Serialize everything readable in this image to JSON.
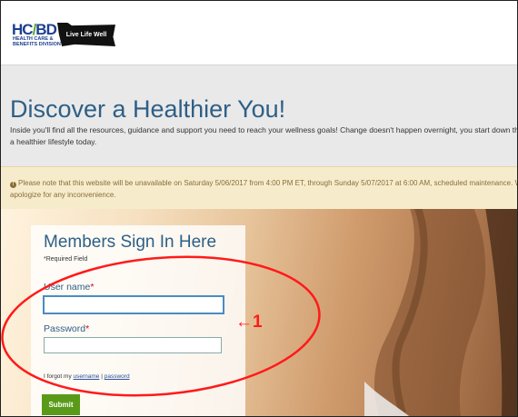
{
  "header": {
    "logo_text": "HC",
    "logo_slash": "/",
    "logo_text2": "BD",
    "logo_sub": "HEALTH CARE & BENEFITS DIVISION",
    "badge": "Live Life Well"
  },
  "hero": {
    "title": "Discover a Healthier You!",
    "description": "Inside you'll find all the resources, guidance and support you need to reach your wellness goals! Change doesn't happen overnight, you start down the path to a healthier lifestyle today."
  },
  "notice": {
    "icon": "info-circle-icon",
    "text": "Please note that this website will be unavailable on Saturday 5/06/2017 from 4:00 PM ET, through Sunday 5/07/2017 at 6:00 AM, scheduled maintenance. We apologize for any inconvenience."
  },
  "signin": {
    "title": "Members Sign In Here",
    "required_note": "*Required Field",
    "username_label": "User name",
    "password_label": "Password",
    "required_star": "*",
    "username_value": "",
    "password_value": "",
    "forgot_prefix": "I forgot my ",
    "forgot_username": "username",
    "forgot_separator": " | ",
    "forgot_password": "password",
    "submit_label": "Submit"
  },
  "annotation": {
    "label": "←1",
    "color": "#ff1a1a"
  },
  "colors": {
    "brand_blue": "#2e5f86",
    "notice_bg": "#f6eccb",
    "submit_green": "#5a9a19"
  }
}
